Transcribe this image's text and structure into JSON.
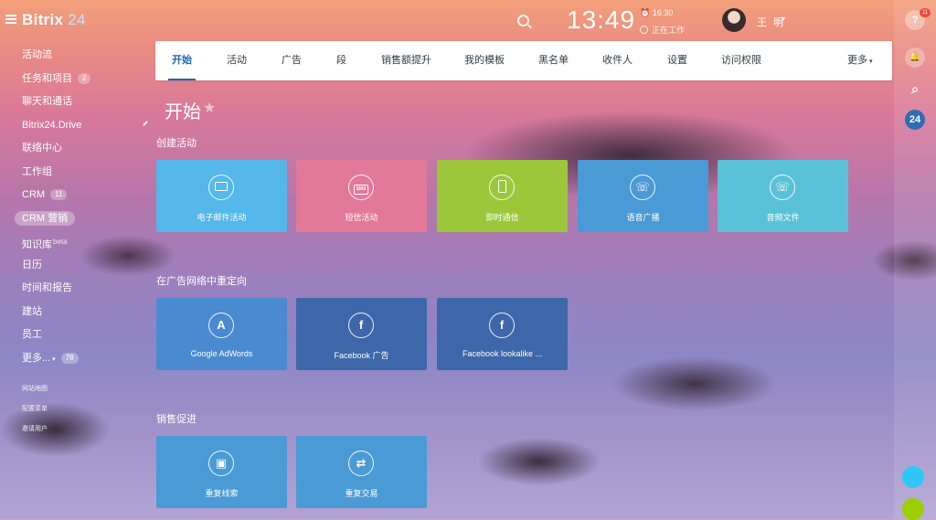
{
  "header": {
    "logo_main": "Bitrix",
    "logo_suffix": " 24",
    "time": "13:49",
    "alarm": "⏰ 16:30",
    "work_status": "正在工作",
    "user_name": "王 明",
    "user_caret": "▾"
  },
  "sidebar": {
    "items": [
      {
        "label": "活动流"
      },
      {
        "label": "任务和项目",
        "counter": "2"
      },
      {
        "label": "聊天和通话"
      },
      {
        "label": "Bitrix24.Drive"
      },
      {
        "label": "联络中心"
      },
      {
        "label": "工作组"
      },
      {
        "label": "CRM",
        "counter": "11"
      },
      {
        "label": "CRM 营销",
        "active": true
      },
      {
        "label": "知识库",
        "sup": "beta"
      },
      {
        "label": "日历"
      },
      {
        "label": "时间和报告"
      },
      {
        "label": "建站"
      },
      {
        "label": "员工"
      },
      {
        "label": "更多...",
        "caret": "▾",
        "counter": "78"
      }
    ],
    "small_items": [
      "网站地图",
      "配置菜单",
      "邀请用户"
    ]
  },
  "tabs": {
    "items": [
      "开始",
      "活动",
      "广告",
      "段",
      "销售额提升",
      "我的模板",
      "黑名单",
      "收件人",
      "设置",
      "访问权限"
    ],
    "more_label": "更多",
    "more_caret": "▾"
  },
  "page": {
    "title": "开始",
    "star": "★"
  },
  "sections": [
    {
      "title": "创建活动",
      "tiles": [
        {
          "label": "电子邮件活动",
          "icon": "email-icon",
          "color": "#55b7ea"
        },
        {
          "label": "短信活动",
          "icon": "sms-icon",
          "color": "#e2789a",
          "icon_text": "SMS"
        },
        {
          "label": "即时通信",
          "icon": "messenger-icon",
          "color": "#9cc73a"
        },
        {
          "label": "语音广播",
          "icon": "voice-broadcast-icon",
          "color": "#4a9ad5",
          "icon_text": "☏"
        },
        {
          "label": "音频文件",
          "icon": "audio-file-icon",
          "color": "#5ac2d8",
          "icon_text": "☏"
        }
      ]
    },
    {
      "title": "在广告网络中重定向",
      "tiles": [
        {
          "label": "Google AdWords",
          "icon": "adwords-icon",
          "color": "#4a8ad0",
          "icon_text": "A"
        },
        {
          "label": "Facebook 广告",
          "icon": "facebook-icon",
          "color": "#3d67a8",
          "icon_text": "f"
        },
        {
          "label": "Facebook lookalike ...",
          "icon": "facebook-lookalike-icon",
          "color": "#3d67a8",
          "icon_text": "f"
        }
      ]
    },
    {
      "title": "销售促进",
      "tiles": [
        {
          "label": "重复线索",
          "icon": "repeat-lead-icon",
          "color": "#4a9ad5",
          "icon_text": "▣"
        },
        {
          "label": "重复交易",
          "icon": "repeat-deal-icon",
          "color": "#4a9ad5",
          "icon_text": "⇄"
        }
      ]
    }
  ],
  "right_panel": {
    "help_label": "?",
    "help_badge": "11",
    "bell_label": "🔔",
    "search_label": "⌕",
    "b24_label": "24"
  }
}
